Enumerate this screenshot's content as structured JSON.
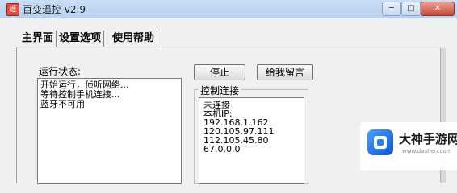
{
  "window": {
    "title": "百变遥控 v2.9",
    "min_glyph": "─",
    "max_glyph": "□",
    "close_glyph": "✕"
  },
  "tabs": [
    {
      "label": "主界面"
    },
    {
      "label": "设置选项"
    },
    {
      "label": "使用帮助"
    }
  ],
  "main": {
    "status_label": "运行状态:",
    "log": [
      "开始运行，侦听网络...",
      "等待控制手机连接...",
      "蓝牙不可用"
    ],
    "stop_button": "停止",
    "message_button": "给我留言",
    "connection_group": {
      "title": "控制连接",
      "lines": [
        "未连接",
        "本机IP:",
        "192.168.1.162",
        "120.105.97.111",
        "112.105.45.80",
        "67.0.0.0"
      ]
    }
  },
  "watermark": {
    "name": "大神手游网",
    "url": "www.dashen.com"
  }
}
